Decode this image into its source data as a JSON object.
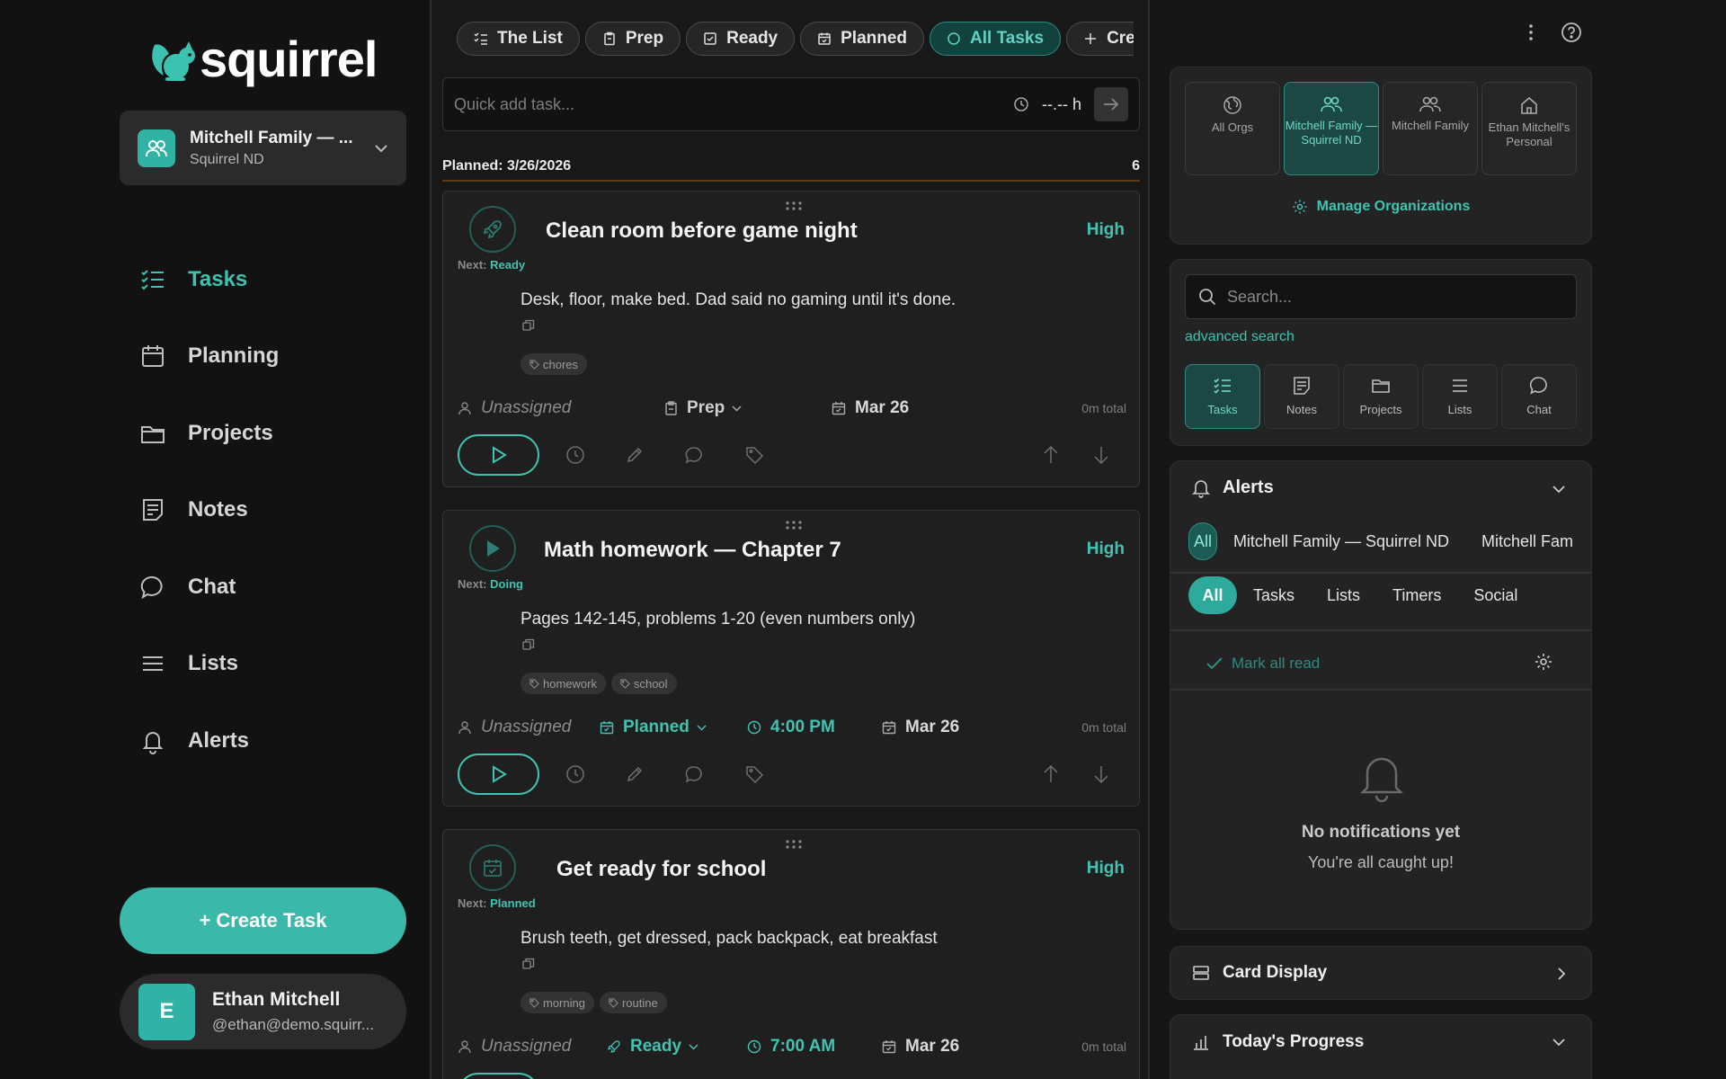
{
  "app": {
    "name": "squirrel",
    "accent": "#3ab8a9"
  },
  "org": {
    "name": "Mitchell Family — ...",
    "sub": "Squirrel ND"
  },
  "nav": {
    "tasks": "Tasks",
    "planning": "Planning",
    "projects": "Projects",
    "notes": "Notes",
    "chat": "Chat",
    "lists": "Lists",
    "alerts": "Alerts"
  },
  "create_task": "+ Create Task",
  "user": {
    "initial": "E",
    "name": "Ethan Mitchell",
    "email": "@ethan@demo.squirr..."
  },
  "filters": {
    "the_list": "The List",
    "prep": "Prep",
    "ready": "Ready",
    "planned": "Planned",
    "all_tasks": "All Tasks",
    "create": "Creat"
  },
  "quick_add": {
    "placeholder": "Quick add task...",
    "hours": "--.-- h"
  },
  "planned_header": {
    "label": "Planned: 3/26/2026",
    "count": "6"
  },
  "tasks": [
    {
      "title": "Clean room before game night",
      "priority": "High",
      "next_label": "Next:",
      "next_state": "Ready",
      "description": "Desk, floor, make bed. Dad said no gaming until it's done.",
      "tags": [
        "chores"
      ],
      "assignee": "Unassigned",
      "status": "Prep",
      "time": "",
      "date": "Mar 26",
      "total": "0m total"
    },
    {
      "title": "Math homework — Chapter 7",
      "priority": "High",
      "next_label": "Next:",
      "next_state": "Doing",
      "description": "Pages 142-145, problems 1-20 (even numbers only)",
      "tags": [
        "homework",
        "school"
      ],
      "assignee": "Unassigned",
      "status": "Planned",
      "time": "4:00 PM",
      "date": "Mar 26",
      "total": "0m total"
    },
    {
      "title": "Get ready for school",
      "priority": "High",
      "next_label": "Next:",
      "next_state": "Planned",
      "description": "Brush teeth, get dressed, pack backpack, eat breakfast",
      "tags": [
        "morning",
        "routine"
      ],
      "assignee": "Unassigned",
      "status": "Ready",
      "time": "7:00 AM",
      "date": "Mar 26",
      "total": "0m total"
    }
  ],
  "org_switcher": {
    "tiles": [
      {
        "label": "All Orgs"
      },
      {
        "label": "Mitchell Family — Squirrel ND"
      },
      {
        "label": "Mitchell Family"
      },
      {
        "label": "Ethan Mitchell's Personal"
      }
    ],
    "manage": "Manage Organizations"
  },
  "search": {
    "placeholder": "Search...",
    "advanced": "advanced search",
    "categories": [
      "Tasks",
      "Notes",
      "Projects",
      "Lists",
      "Chat"
    ]
  },
  "alerts": {
    "title": "Alerts",
    "org_filters": [
      "All",
      "Mitchell Family — Squirrel ND",
      "Mitchell Fam"
    ],
    "type_filters": [
      "All",
      "Tasks",
      "Lists",
      "Timers",
      "Social"
    ],
    "mark_all_read": "Mark all read",
    "empty_title": "No notifications yet",
    "empty_sub": "You're all caught up!"
  },
  "card_display": "Card Display",
  "todays_progress": "Today's Progress"
}
